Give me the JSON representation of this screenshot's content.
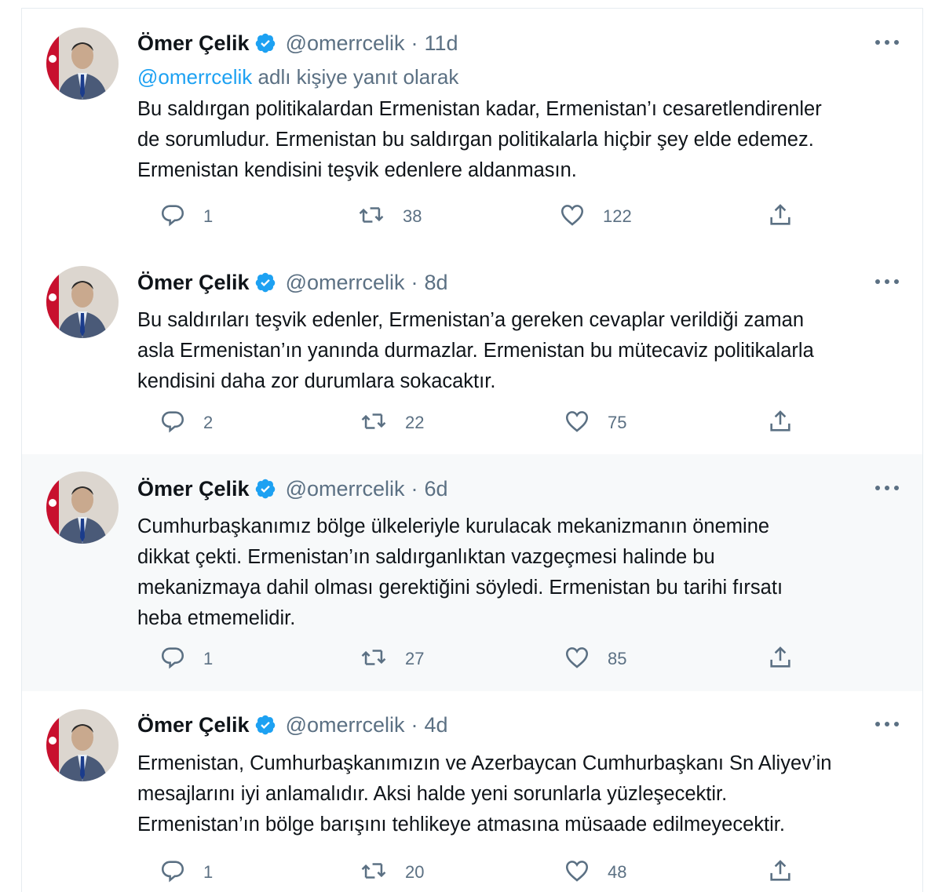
{
  "author": {
    "name": "Ömer Çelik",
    "handle": "@omerrcelik"
  },
  "colors": {
    "accent": "#1da1f2",
    "muted": "#5b7083",
    "text": "#0f1419",
    "highlight_bg": "#f7f9fa",
    "thread_line": "#c4cfd6"
  },
  "icons": {
    "verified": "verified-badge-icon",
    "more": "more-dots-icon",
    "reply": "reply-bubble-icon",
    "retweet": "retweet-icon",
    "like": "heart-icon",
    "share": "share-icon"
  },
  "tweets": [
    {
      "time": "11d",
      "reply_to": {
        "mention": "@omerrcelik",
        "suffix": " adlı kişiye yanıt olarak"
      },
      "lines": [
        "Bu saldırgan politikalardan Ermenistan kadar, Ermenistan’ı cesaretlendirenler",
        "de sorumludur. Ermenistan bu saldırgan politikalarla hiçbir şey elde edemez.",
        "Ermenistan kendisini teşvik edenlere aldanmasın."
      ],
      "replies": "1",
      "retweets": "38",
      "likes": "122"
    },
    {
      "time": "8d",
      "lines": [
        "Bu saldırıları teşvik edenler, Ermenistan’a gereken cevaplar verildiği zaman",
        "asla Ermenistan’ın yanında durmazlar. Ermenistan bu mütecaviz politikalarla",
        "kendisini daha zor durumlara sokacaktır."
      ],
      "replies": "2",
      "retweets": "22",
      "likes": "75"
    },
    {
      "time": "6d",
      "lines": [
        "Cumhurbaşkanımız  bölge ülkeleriyle kurulacak mekanizmanın önemine",
        "dikkat çekti. Ermenistan’ın saldırganlıktan vazgeçmesi halinde bu",
        "mekanizmaya dahil olması gerektiğini söyledi. Ermenistan bu tarihi fırsatı",
        "heba etmemelidir."
      ],
      "replies": "1",
      "retweets": "27",
      "likes": "85"
    },
    {
      "time": "4d",
      "lines": [
        "Ermenistan, Cumhurbaşkanımızın ve Azerbaycan Cumhurbaşkanı Sn Aliyev’in",
        "mesajlarını iyi anlamalıdır. Aksi halde yeni sorunlarla yüzleşecektir.",
        "Ermenistan’ın bölge barışını tehlikeye atmasına müsaade edilmeyecektir."
      ],
      "replies": "1",
      "retweets": "20",
      "likes": "48"
    }
  ]
}
